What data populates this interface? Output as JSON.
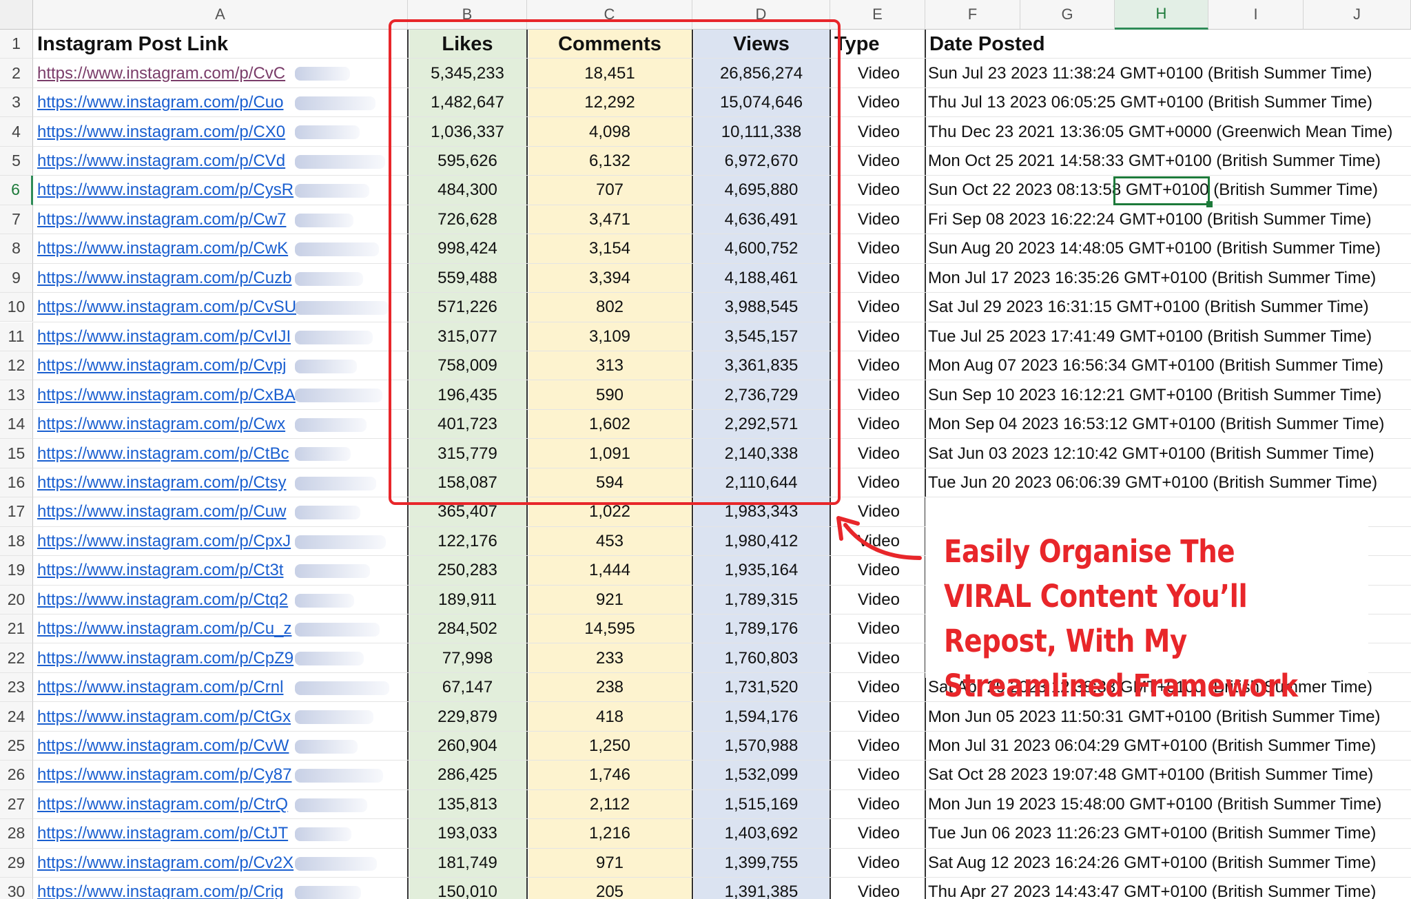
{
  "columns": [
    "A",
    "B",
    "C",
    "D",
    "E",
    "F",
    "G",
    "H",
    "I",
    "J"
  ],
  "headers": {
    "link": "Instagram Post Link",
    "likes": "Likes",
    "comments": "Comments",
    "views": "Views",
    "type": "Type",
    "date": "Date Posted"
  },
  "selected": {
    "column": "H",
    "row": "6"
  },
  "rows": [
    {
      "n": "2",
      "link": "https://www.instagram.com/p/CvC",
      "likes": "5,345,233",
      "comments": "18,451",
      "views": "26,856,274",
      "type": "Video",
      "date": "Sun Jul 23 2023 11:38:24 GMT+0100 (British Summer Time)"
    },
    {
      "n": "3",
      "link": "https://www.instagram.com/p/Cuo",
      "likes": "1,482,647",
      "comments": "12,292",
      "views": "15,074,646",
      "type": "Video",
      "date": "Thu Jul 13 2023 06:05:25 GMT+0100 (British Summer Time)"
    },
    {
      "n": "4",
      "link": "https://www.instagram.com/p/CX0",
      "likes": "1,036,337",
      "comments": "4,098",
      "views": "10,111,338",
      "type": "Video",
      "date": "Thu Dec 23 2021 13:36:05 GMT+0000 (Greenwich Mean Time)"
    },
    {
      "n": "5",
      "link": "https://www.instagram.com/p/CVd",
      "likes": "595,626",
      "comments": "6,132",
      "views": "6,972,670",
      "type": "Video",
      "date": "Mon Oct 25 2021 14:58:33 GMT+0100 (British Summer Time)"
    },
    {
      "n": "6",
      "link": "https://www.instagram.com/p/CysR",
      "likes": "484,300",
      "comments": "707",
      "views": "4,695,880",
      "type": "Video",
      "date": "Sun Oct 22 2023 08:13:58 GMT+0100 (British Summer Time)"
    },
    {
      "n": "7",
      "link": "https://www.instagram.com/p/Cw7",
      "likes": "726,628",
      "comments": "3,471",
      "views": "4,636,491",
      "type": "Video",
      "date": "Fri Sep 08 2023 16:22:24 GMT+0100 (British Summer Time)"
    },
    {
      "n": "8",
      "link": "https://www.instagram.com/p/CwK",
      "likes": "998,424",
      "comments": "3,154",
      "views": "4,600,752",
      "type": "Video",
      "date": "Sun Aug 20 2023 14:48:05 GMT+0100 (British Summer Time)"
    },
    {
      "n": "9",
      "link": "https://www.instagram.com/p/Cuzb",
      "likes": "559,488",
      "comments": "3,394",
      "views": "4,188,461",
      "type": "Video",
      "date": "Mon Jul 17 2023 16:35:26 GMT+0100 (British Summer Time)"
    },
    {
      "n": "10",
      "link": "https://www.instagram.com/p/CvSU",
      "likes": "571,226",
      "comments": "802",
      "views": "3,988,545",
      "type": "Video",
      "date": "Sat Jul 29 2023 16:31:15 GMT+0100 (British Summer Time)"
    },
    {
      "n": "11",
      "link": "https://www.instagram.com/p/CvIJI",
      "likes": "315,077",
      "comments": "3,109",
      "views": "3,545,157",
      "type": "Video",
      "date": "Tue Jul 25 2023 17:41:49 GMT+0100 (British Summer Time)"
    },
    {
      "n": "12",
      "link": "https://www.instagram.com/p/Cvpj",
      "likes": "758,009",
      "comments": "313",
      "views": "3,361,835",
      "type": "Video",
      "date": "Mon Aug 07 2023 16:56:34 GMT+0100 (British Summer Time)"
    },
    {
      "n": "13",
      "link": "https://www.instagram.com/p/CxBA",
      "likes": "196,435",
      "comments": "590",
      "views": "2,736,729",
      "type": "Video",
      "date": "Sun Sep 10 2023 16:12:21 GMT+0100 (British Summer Time)"
    },
    {
      "n": "14",
      "link": "https://www.instagram.com/p/Cwx",
      "likes": "401,723",
      "comments": "1,602",
      "views": "2,292,571",
      "type": "Video",
      "date": "Mon Sep 04 2023 16:53:12 GMT+0100 (British Summer Time)"
    },
    {
      "n": "15",
      "link": "https://www.instagram.com/p/CtBc",
      "likes": "315,779",
      "comments": "1,091",
      "views": "2,140,338",
      "type": "Video",
      "date": "Sat Jun 03 2023 12:10:42 GMT+0100 (British Summer Time)"
    },
    {
      "n": "16",
      "link": "https://www.instagram.com/p/Ctsy",
      "likes": "158,087",
      "comments": "594",
      "views": "2,110,644",
      "type": "Video",
      "date": "Tue Jun 20 2023 06:06:39 GMT+0100 (British Summer Time)"
    },
    {
      "n": "17",
      "link": "https://www.instagram.com/p/Cuw",
      "likes": "365,407",
      "comments": "1,022",
      "views": "1,983,343",
      "type": "Video",
      "date": ""
    },
    {
      "n": "18",
      "link": "https://www.instagram.com/p/CpxJ",
      "likes": "122,176",
      "comments": "453",
      "views": "1,980,412",
      "type": "Video",
      "date": ""
    },
    {
      "n": "19",
      "link": "https://www.instagram.com/p/Ct3t",
      "likes": "250,283",
      "comments": "1,444",
      "views": "1,935,164",
      "type": "Video",
      "date": ""
    },
    {
      "n": "20",
      "link": "https://www.instagram.com/p/Ctq2",
      "likes": "189,911",
      "comments": "921",
      "views": "1,789,315",
      "type": "Video",
      "date": ""
    },
    {
      "n": "21",
      "link": "https://www.instagram.com/p/Cu_z",
      "likes": "284,502",
      "comments": "14,595",
      "views": "1,789,176",
      "type": "Video",
      "date": ""
    },
    {
      "n": "22",
      "link": "https://www.instagram.com/p/CpZ9",
      "likes": "77,998",
      "comments": "233",
      "views": "1,760,803",
      "type": "Video",
      "date": ""
    },
    {
      "n": "23",
      "link": "https://www.instagram.com/p/Crnl",
      "likes": "67,147",
      "comments": "238",
      "views": "1,731,520",
      "type": "Video",
      "date": "Sat Apr 29 2023 12:38:33 GMT+0100 (British Summer Time)"
    },
    {
      "n": "24",
      "link": "https://www.instagram.com/p/CtGx",
      "likes": "229,879",
      "comments": "418",
      "views": "1,594,176",
      "type": "Video",
      "date": "Mon Jun 05 2023 11:50:31 GMT+0100 (British Summer Time)"
    },
    {
      "n": "25",
      "link": "https://www.instagram.com/p/CvW",
      "likes": "260,904",
      "comments": "1,250",
      "views": "1,570,988",
      "type": "Video",
      "date": "Mon Jul 31 2023 06:04:29 GMT+0100 (British Summer Time)"
    },
    {
      "n": "26",
      "link": "https://www.instagram.com/p/Cy87",
      "likes": "286,425",
      "comments": "1,746",
      "views": "1,532,099",
      "type": "Video",
      "date": "Sat Oct 28 2023 19:07:48 GMT+0100 (British Summer Time)"
    },
    {
      "n": "27",
      "link": "https://www.instagram.com/p/CtrQ",
      "likes": "135,813",
      "comments": "2,112",
      "views": "1,515,169",
      "type": "Video",
      "date": "Mon Jun 19 2023 15:48:00 GMT+0100 (British Summer Time)"
    },
    {
      "n": "28",
      "link": "https://www.instagram.com/p/CtJT",
      "likes": "193,033",
      "comments": "1,216",
      "views": "1,403,692",
      "type": "Video",
      "date": "Tue Jun 06 2023 11:26:23 GMT+0100 (British Summer Time)"
    },
    {
      "n": "29",
      "link": "https://www.instagram.com/p/Cv2X",
      "likes": "181,749",
      "comments": "971",
      "views": "1,399,755",
      "type": "Video",
      "date": "Sat Aug 12 2023 16:24:26 GMT+0100 (British Summer Time)"
    },
    {
      "n": "30",
      "link": "https://www.instagram.com/p/Crig",
      "likes": "150,010",
      "comments": "205",
      "views": "1,391,385",
      "type": "Video",
      "date": "Thu Apr 27 2023 14:43:47 GMT+0100 (British Summer Time)"
    }
  ],
  "callout": {
    "text": "Easily Organise The VIRAL Content You’ll Repost, With My Streamlined Framework"
  },
  "colors": {
    "accent_red": "#e8262a",
    "likes_band": "#e2eedb",
    "comments_band": "#fdf3cf",
    "views_band": "#dbe3f1",
    "selection": "#1d7a3a"
  }
}
